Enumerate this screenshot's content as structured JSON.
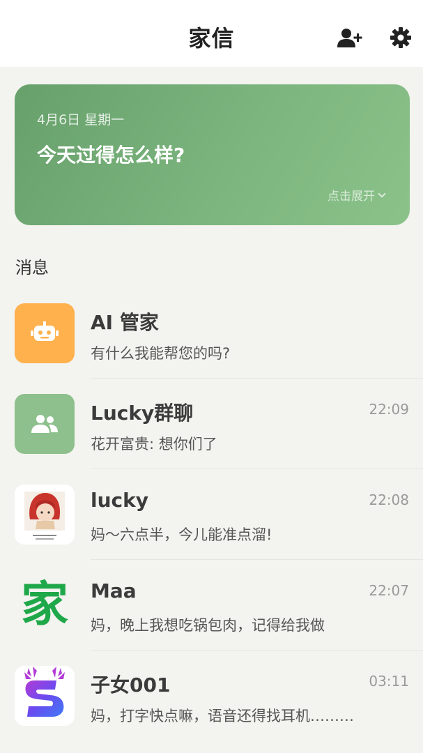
{
  "header": {
    "title": "家信"
  },
  "banner": {
    "date": "4月6日 星期一",
    "question": "今天过得怎么样?",
    "expand_label": "点击展开"
  },
  "section": {
    "messages_label": "消息"
  },
  "messages": [
    {
      "name": "AI 管家",
      "time": "",
      "preview": "有什么我能帮您的吗?",
      "avatar_icon": "robot-icon",
      "avatar_color": "#ffb14e"
    },
    {
      "name": "Lucky群聊",
      "time": "22:09",
      "preview": "花开富贵: 想你们了",
      "avatar_icon": "group-icon",
      "avatar_color": "#8dc08c"
    },
    {
      "name": "lucky",
      "time": "22:08",
      "preview": "妈～六点半，今儿能准点溜!",
      "avatar_icon": "photo-avatar"
    },
    {
      "name": "Maa",
      "time": "22:07",
      "preview": "妈，晚上我想吃锅包肉，记得给我做",
      "avatar_text": "家",
      "avatar_color": "#1fa84a"
    },
    {
      "name": "子女001",
      "time": "03:11",
      "preview": "妈，打字快点嘛，语音还得找耳机………",
      "avatar_icon": "deer-s-logo-icon"
    }
  ]
}
